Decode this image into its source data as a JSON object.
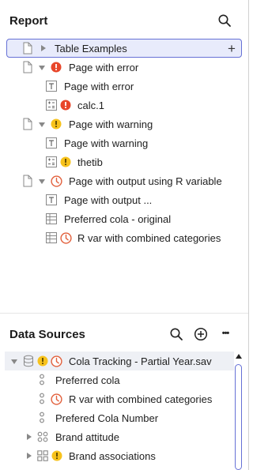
{
  "report": {
    "title": "Report",
    "items": [
      {
        "label": "Table Examples"
      },
      {
        "label": "Page with error"
      },
      {
        "label": "Page with error"
      },
      {
        "label": "calc.1"
      },
      {
        "label": "Page with warning"
      },
      {
        "label": "Page with warning"
      },
      {
        "label": "thetib"
      },
      {
        "label": "Page with output using R variable"
      },
      {
        "label": "Page with output ..."
      },
      {
        "label": "Preferred cola - original"
      },
      {
        "label": "R var with combined categories"
      }
    ],
    "add_symbol": "+"
  },
  "data_sources": {
    "title": "Data Sources",
    "more_symbol": "•••",
    "items": [
      {
        "label": "Cola Tracking - Partial Year.sav"
      },
      {
        "label": "Preferred cola"
      },
      {
        "label": "R var with combined categories"
      },
      {
        "label": "Prefered Cola Number"
      },
      {
        "label": "Brand attitude"
      },
      {
        "label": "Brand associations"
      }
    ]
  },
  "colors": {
    "error": "#e8462a",
    "warning": "#f7c21c",
    "r_variable": "#e2603c",
    "accent": "#6671d6"
  }
}
